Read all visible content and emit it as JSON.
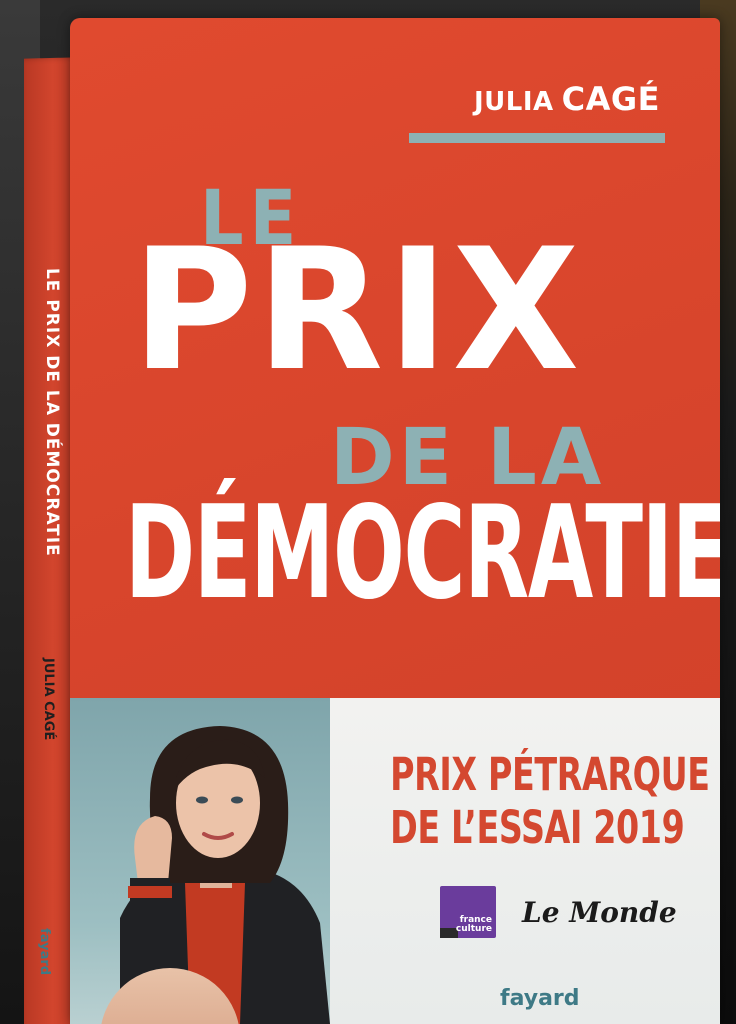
{
  "book": {
    "author_first": "JULIA",
    "author_last": "CAGÉ",
    "title_le": "LE",
    "title_prix": "PRIX",
    "title_dela": "DE LA",
    "title_democratie": "DÉMOCRATIE",
    "spine_title": "LE PRIX DE LA DÉMOCRATIE",
    "spine_author": "JULIA CAGÉ",
    "spine_publisher": "fayard",
    "prize_line1": "PRIX PÉTRARQUE",
    "prize_line2": "DE L’ESSAI 2019",
    "france_culture": "france culture",
    "le_monde": "Le Monde",
    "publisher": "fayard"
  },
  "colors": {
    "cover_red": "#d8452c",
    "accent_blue": "#8db1b4",
    "prize_red": "#d44830",
    "fayard_teal": "#3e7a86",
    "france_culture_purple": "#6a3c9c"
  }
}
